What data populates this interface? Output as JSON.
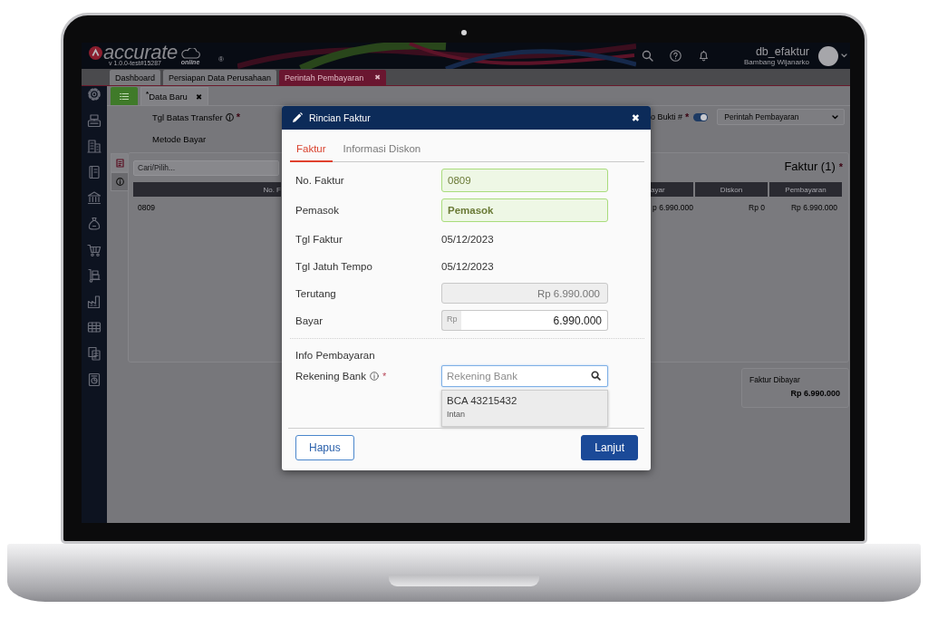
{
  "header": {
    "logo": "accurate",
    "logo_tag": "online",
    "version": "v 1.0.0-test#15287",
    "trademark": "®",
    "database": "db_efaktur",
    "user": "Bambang Wijanarko"
  },
  "tabs": [
    {
      "label": "Dashboard",
      "selected": false
    },
    {
      "label": "Persiapan Data Perusahaan",
      "selected": false
    },
    {
      "label": "Perintah Pembayaran",
      "selected": true,
      "close": "✖"
    }
  ],
  "subtabs": [
    {
      "label": "$^{*}$Data Baru",
      "selected": true,
      "close": "✖"
    }
  ],
  "form": {
    "fields": [
      {
        "label": "Tgl Batas Transfer",
        "info": true,
        "required_mark": "*"
      },
      {
        "label": "Metode Bayar",
        "info": false
      }
    ],
    "number": {
      "label": "o Bukti #",
      "required_mark": "*",
      "toggle_on": true,
      "type_value": "Perintah Pembayaran"
    }
  },
  "invoices": {
    "tabs": [
      {
        "selected": true
      },
      {
        "selected": false
      }
    ],
    "search": {
      "placeholder": "Cari/Pilih..."
    },
    "title": "Faktur (1)",
    "title_mark": "*",
    "columns": [
      "No. F",
      "ayar",
      "Diskon",
      "Pembayaran"
    ],
    "rows": [
      [
        "0809",
        "p 6.990.000",
        "Rp 0",
        "Rp 6.990.000"
      ]
    ]
  },
  "summary": {
    "label": "Faktur Dibayar",
    "value": "Rp 6.990.000"
  },
  "dialog": {
    "title": "Rincian Faktur",
    "close": "✖",
    "tabs": [
      {
        "label": "Faktur",
        "selected": true
      },
      {
        "label": "Informasi Diskon",
        "selected": false
      }
    ],
    "fields": [
      {
        "kind": "valid",
        "label": "No. Faktur",
        "value": "0809",
        "bold": false
      },
      {
        "kind": "valid",
        "label": "Pemasok",
        "value": "Pemasok",
        "bold": true
      },
      {
        "kind": "text",
        "label": "Tgl Faktur",
        "value": "05/12/2023"
      },
      {
        "kind": "text",
        "label": "Tgl Jatuh Tempo",
        "value": "05/12/2023"
      },
      {
        "kind": "readonly",
        "label": "Terutang",
        "value": "Rp 6.990.000"
      },
      {
        "kind": "currency",
        "label": "Bayar",
        "prefix": "Rp",
        "value": "6.990.000"
      }
    ],
    "section": "Info Pembayaran",
    "bank": {
      "label": "Rekening Bank",
      "info": true,
      "required_mark": "*",
      "placeholder": "Rekening Bank",
      "options": [
        {
          "title": "BCA 43215432",
          "subtitle": "Intan",
          "selected": true
        }
      ]
    },
    "buttons": [
      {
        "label": "Hapus",
        "kind": "secondary"
      },
      {
        "label": "Lanjut",
        "kind": "primary"
      }
    ]
  }
}
